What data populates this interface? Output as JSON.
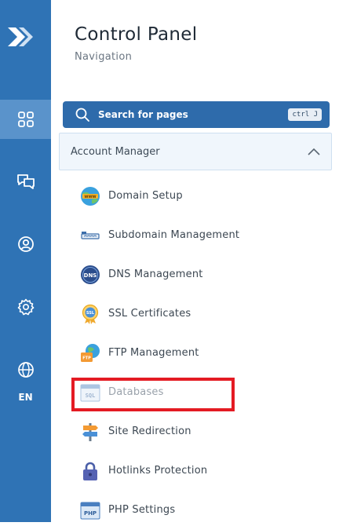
{
  "app": {
    "title": "Control Panel",
    "subtitle": "Navigation"
  },
  "rail": {
    "items": [
      {
        "name": "dashboard",
        "icon": "grid-icon",
        "active": true
      },
      {
        "name": "support",
        "icon": "chat-icon",
        "active": false
      },
      {
        "name": "account",
        "icon": "user-icon",
        "active": false
      },
      {
        "name": "settings",
        "icon": "gear-icon",
        "active": false
      },
      {
        "name": "language",
        "icon": "globe-icon",
        "active": false
      }
    ],
    "language": "EN"
  },
  "search": {
    "label": "Search for pages",
    "shortcut": "ctrl J"
  },
  "section": {
    "title": "Account Manager"
  },
  "menu": [
    {
      "label": "Domain Setup",
      "icon": "www-globe-icon"
    },
    {
      "label": "Subdomain Management",
      "icon": "subdomain-icon"
    },
    {
      "label": "DNS Management",
      "icon": "dns-icon"
    },
    {
      "label": "SSL Certificates",
      "icon": "ssl-badge-icon"
    },
    {
      "label": "FTP Management",
      "icon": "ftp-icon"
    },
    {
      "label": "Databases",
      "icon": "sql-icon"
    },
    {
      "label": "Site Redirection",
      "icon": "signpost-icon"
    },
    {
      "label": "Hotlinks Protection",
      "icon": "lock-icon"
    },
    {
      "label": "PHP Settings",
      "icon": "php-icon"
    }
  ],
  "colors": {
    "rail": "#2f73b5",
    "search": "#2e6bab",
    "highlight": "#e41b23"
  }
}
